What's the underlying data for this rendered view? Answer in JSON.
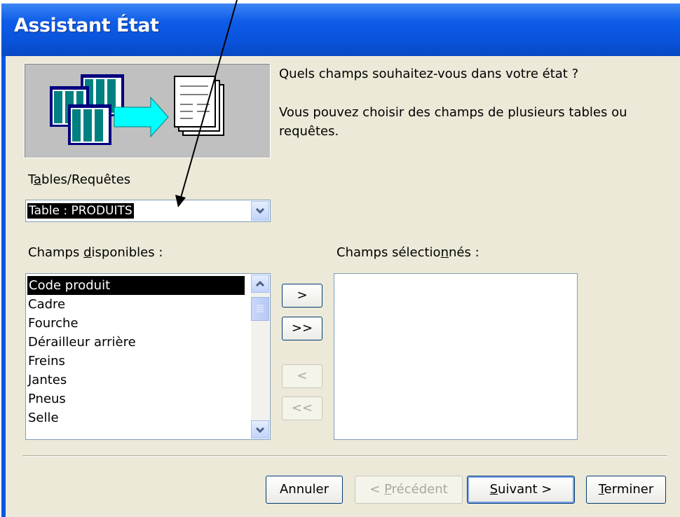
{
  "window": {
    "title": "Assistant État"
  },
  "prompt": {
    "question": "Quels champs souhaitez-vous dans votre état ?",
    "hint_line1": "Vous pouvez choisir des champs de plusieurs tables ou",
    "hint_line2": "requêtes."
  },
  "tables": {
    "label_pre": "T",
    "label_u": "a",
    "label_post": "bles/Requêtes",
    "selected": "Table : PRODUITS"
  },
  "available": {
    "label_pre": "Champs ",
    "label_u": "d",
    "label_post": "isponibles :",
    "items": [
      "Code produit",
      "Cadre",
      "Fourche",
      "Dérailleur arrière",
      "Freins",
      "Jantes",
      "Pneus",
      "Selle"
    ]
  },
  "selected_fields": {
    "label_pre": "Champs sélectio",
    "label_u": "n",
    "label_post": "nés :"
  },
  "move_buttons": {
    "add_one": ">",
    "add_all": ">>",
    "remove_one": "<",
    "remove_all": "<<"
  },
  "footer": {
    "cancel": "Annuler",
    "previous_pre": "< ",
    "previous_u": "P",
    "previous_post": "récédent",
    "next_u": "S",
    "next_post": "uivant >",
    "finish_u": "T",
    "finish_post": "erminer"
  },
  "colors": {
    "title_bar": "#0a55e2",
    "dialog_bg": "#ece9d8",
    "selection": "#000000"
  }
}
